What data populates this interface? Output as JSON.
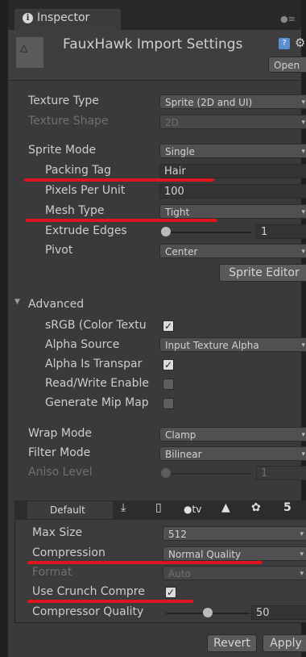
{
  "tab": {
    "label": "Inspector"
  },
  "header": {
    "title": "FauxHawk Import Settings",
    "open_label": "Open"
  },
  "texture": {
    "type_label": "Texture Type",
    "type_value": "Sprite (2D and UI)",
    "shape_label": "Texture Shape",
    "shape_value": "2D"
  },
  "sprite": {
    "mode_label": "Sprite Mode",
    "mode_value": "Single",
    "packing_tag_label": "Packing Tag",
    "packing_tag_value": "Hair",
    "ppu_label": "Pixels Per Unit",
    "ppu_value": "100",
    "mesh_type_label": "Mesh Type",
    "mesh_type_value": "Tight",
    "extrude_label": "Extrude Edges",
    "extrude_value": "1",
    "pivot_label": "Pivot",
    "pivot_value": "Center",
    "editor_button": "Sprite Editor"
  },
  "advanced": {
    "header": "Advanced",
    "srgb_label": "sRGB (Color Textu",
    "srgb_checked": true,
    "alpha_source_label": "Alpha Source",
    "alpha_source_value": "Input Texture Alpha",
    "alpha_transparency_label": "Alpha Is Transpar",
    "alpha_transparency_checked": true,
    "read_write_label": "Read/Write Enable",
    "read_write_checked": false,
    "mipmaps_label": "Generate Mip Map",
    "mipmaps_checked": false
  },
  "wrap": {
    "label": "Wrap Mode",
    "value": "Clamp"
  },
  "filter": {
    "label": "Filter Mode",
    "value": "Bilinear"
  },
  "aniso": {
    "label": "Aniso Level",
    "value": "1"
  },
  "platforms": {
    "default_tab": "Default",
    "icons": [
      "download-icon",
      "phone-icon",
      "appletv-icon",
      "android-icon",
      "tizen-icon",
      "html5-icon"
    ],
    "appletv_text": "tv",
    "html5_text": "5"
  },
  "platform_settings": {
    "max_size_label": "Max Size",
    "max_size_value": "512",
    "compression_label": "Compression",
    "compression_value": "Normal Quality",
    "format_label": "Format",
    "format_value": "Auto",
    "crunch_label": "Use Crunch Compre",
    "crunch_checked": true,
    "quality_label": "Compressor Quality",
    "quality_value": "50"
  },
  "footer": {
    "revert": "Revert",
    "apply": "Apply"
  },
  "colors": {
    "annotation_red": "#e0141e",
    "panel_bg": "#3a3a3a"
  }
}
